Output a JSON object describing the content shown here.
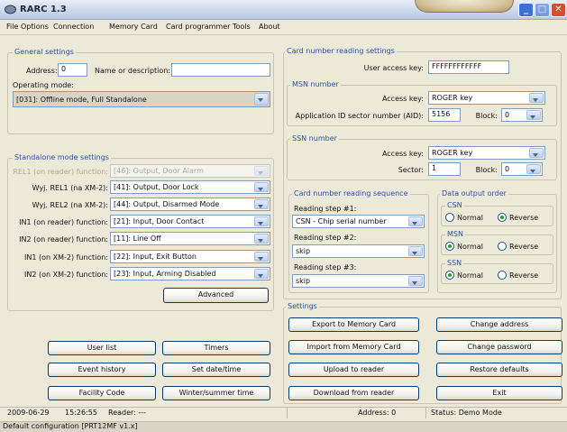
{
  "window": {
    "title": "RARC 1.3"
  },
  "menu": [
    "File",
    "Options",
    "Connection",
    "Memory Card",
    "Card programmer",
    "Tools",
    "About"
  ],
  "general": {
    "group_label": "General settings",
    "address_label": "Address:",
    "address_value": "0",
    "name_label": "Name or description:",
    "name_value": "",
    "mode_label": "Operating mode:",
    "mode_value": "[031]: Offline mode, Full Standalone"
  },
  "standalone": {
    "group_label": "Standalone mode settings",
    "rows": [
      {
        "label": "REL1 (on reader) function:",
        "value": "[46]: Output, Door Alarm",
        "disabled": true
      },
      {
        "label": "Wyj. REL1 (na XM-2):",
        "value": "[41]: Output, Door Lock"
      },
      {
        "label": "Wyj. REL2 (na XM-2):",
        "value": "[44]: Output, Disarmed Mode"
      },
      {
        "label": "IN1 (on reader) function:",
        "value": "[21]: Input, Door Contact"
      },
      {
        "label": "IN2 (on reader) function:",
        "value": "[11]: Line Off"
      },
      {
        "label": "IN1 (on XM-2) function:",
        "value": "[22]: Input, Exit Button"
      },
      {
        "label": "IN2 (on XM-2) function:",
        "value": "[23]: Input, Arming Disabled"
      }
    ],
    "advanced_button": "Advanced"
  },
  "left_buttons": {
    "user_list": "User list",
    "timers": "Timers",
    "event_history": "Event history",
    "set_datetime": "Set date/time",
    "facility_code": "Facility Code",
    "winter_summer": "Winter/summer time"
  },
  "card_settings": {
    "group_label": "Card number reading settings",
    "user_key_label": "User access key:",
    "user_key_value": "FFFFFFFFFFFF",
    "msn": {
      "group_label": "MSN number",
      "access_key_label": "Access key:",
      "access_key_value": "ROGER key",
      "aid_label": "Application ID sector number (AID):",
      "aid_value": "5156",
      "block_label": "Block:",
      "block_value": "0"
    },
    "ssn": {
      "group_label": "SSN number",
      "access_key_label": "Access key:",
      "access_key_value": "ROGER key",
      "sector_label": "Sector:",
      "sector_value": "1",
      "block_label": "Block:",
      "block_value": "0"
    }
  },
  "sequence": {
    "group_label": "Card number reading sequence",
    "step1_label": "Reading step #1:",
    "step1_value": "CSN - Chip serial number",
    "step2_label": "Reading step #2:",
    "step2_value": "skip",
    "step3_label": "Reading step #3:",
    "step3_value": "skip"
  },
  "output_order": {
    "group_label": "Data output order",
    "csn_label": "CSN",
    "msn_label": "MSN",
    "ssn_label": "SSN",
    "normal": "Normal",
    "reverse": "Reverse",
    "csn_selected": "Reverse",
    "msn_selected": "Normal",
    "ssn_selected": "Normal"
  },
  "settings": {
    "group_label": "Settings",
    "export": "Export to Memory Card",
    "import": "Import from Memory Card",
    "upload": "Upload to reader",
    "download": "Download from reader",
    "change_address": "Change address",
    "change_password": "Change password",
    "restore_defaults": "Restore defaults",
    "exit": "Exit"
  },
  "status": {
    "date": "2009-06-29",
    "time": "15:26:55",
    "reader": "Reader: ---",
    "address": "Address: 0",
    "status": "Status: Demo Mode"
  },
  "bottom_text": "Default configuration [PRT12MF v1.x]"
}
